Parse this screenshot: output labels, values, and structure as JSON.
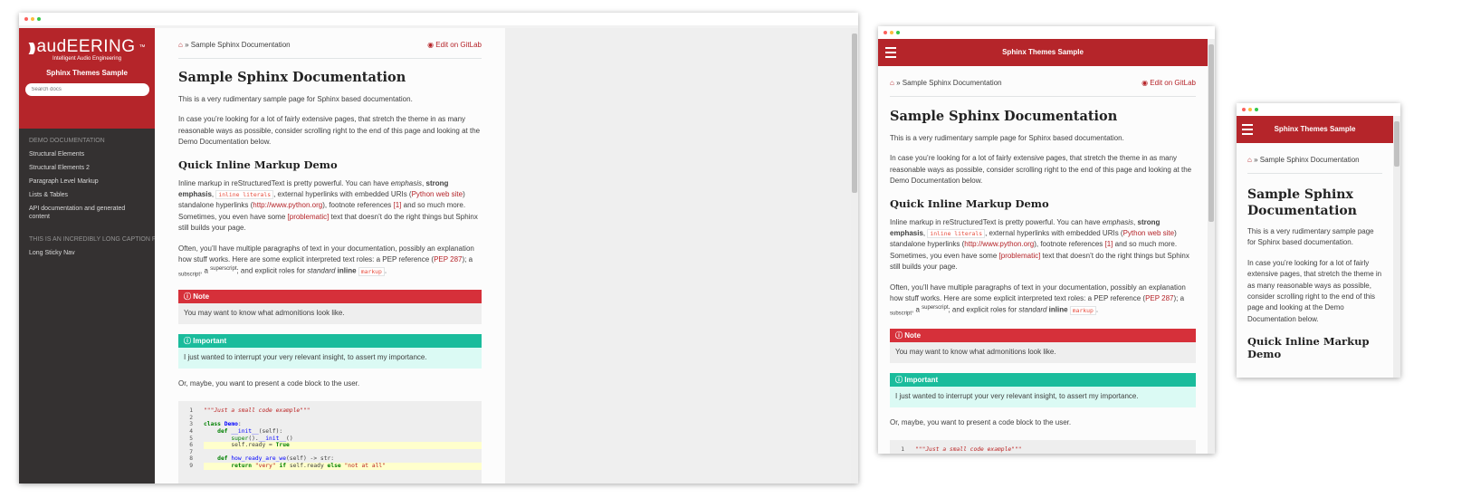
{
  "home_icon": "home-icon",
  "breadcrumb_sep": "»",
  "breadcrumb": "Sample Sphinx Documentation",
  "edit": "Edit on GitLab",
  "brand": {
    "name": "audEERING",
    "tm": "™",
    "tagline": "Intelligent Audio Engineering"
  },
  "project": "Sphinx Themes Sample",
  "search_placeholder": "Search docs",
  "nav": {
    "section1": "DEMO DOCUMENTATION",
    "items": [
      "Structural Elements",
      "Structural Elements 2",
      "Paragraph Level Markup",
      "Lists & Tables",
      "API documentation and generated content"
    ],
    "section2": "THIS IS AN INCREDIBLY LONG CAPTION FOR A NAV",
    "items2": [
      "Long Sticky Nav"
    ]
  },
  "page": {
    "title": "Sample Sphinx Documentation",
    "p1": "This is a very rudimentary sample page for Sphinx based documentation.",
    "p2": "In case you’re looking for a lot of fairly extensive pages, that stretch the theme in as many reasonable ways as possible, consider scrolling right to the end of this page and looking at the Demo Documentation below.",
    "h2": "Quick Inline Markup Demo",
    "p3": {
      "a": "Inline markup in reStructuredText is pretty powerful. You can have ",
      "em": "emphasis",
      "b": ", ",
      "strong": "strong emphasis",
      "c": ", ",
      "lit": "inline literals",
      "d": ", external hyperlinks with embedded URIs (",
      "link1": "Python web site",
      "e": ") standalone hyperlinks (",
      "link2": "http://www.python.org",
      "f": "), footnote references ",
      "fn": "[1]",
      "g": " and so much more. Sometimes, you even have some ",
      "prob": "[problematic]",
      "h": " text that doesn’t do the right things but Sphinx still builds your page."
    },
    "p4": {
      "a": "Often, you’ll have multiple paragraphs of text in your documentation, possibly an explanation how stuff works. Here are some explicit interpreted text roles: a PEP reference (",
      "pep": "PEP 287",
      "b": "); a ",
      "sub": "subscript",
      "c": ", a ",
      "sup": "superscript",
      "d": "; and explicit roles for ",
      "em": "standard",
      "e": " ",
      "strong": "inline",
      "f": " ",
      "lit": "markup",
      "g": "."
    },
    "note_title": "Note",
    "note_body": "You may want to know what admonitions look like.",
    "imp_title": "Important",
    "imp_body": "I just wanted to interrupt your very relevant insight, to assert my importance.",
    "p5": "Or, maybe, you want to present a code block to the user.",
    "code": {
      "l1": "\"\"\"Just a small code example\"\"\"",
      "l3a": "class ",
      "l3b": "Demo",
      "l3c": ":",
      "l4a": "    def ",
      "l4b": "__init__",
      "l4c": "(self):",
      "l5a": "        ",
      "l5b": "super",
      "l5c": "().",
      "l5d": "__init__",
      "l5e": "()",
      "l6a": "        self.ready = ",
      "l6b": "True",
      "l8a": "    def ",
      "l8b": "how_ready_are_we",
      "l8c": "(self) -> str:",
      "l9a": "        ",
      "l9b": "return",
      "l9c": " ",
      "l9d": "\"very\"",
      "l9e": " ",
      "l9f": "if",
      "l9g": " self.ready ",
      "l9h": "else",
      "l9i": " ",
      "l9j": "\"not at all\""
    },
    "line_numbers": [
      "1",
      "2",
      "3",
      "4",
      "5",
      "6",
      "7",
      "8",
      "9"
    ]
  },
  "colors": {
    "brand": "#b5252a",
    "sidebar": "#343131",
    "note": "#d6303a",
    "important": "#1abc9c"
  }
}
